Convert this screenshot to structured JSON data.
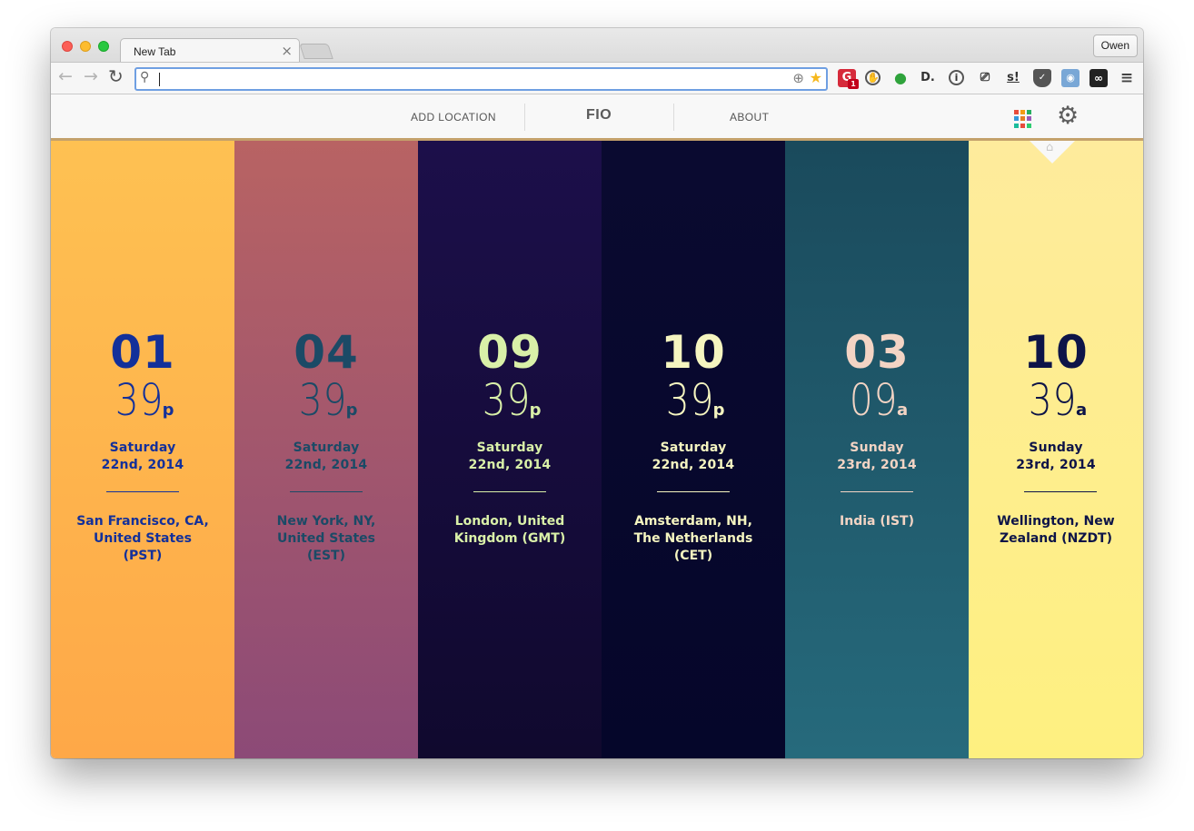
{
  "browser": {
    "tab_title": "New Tab",
    "tab_close": "×",
    "profile_name": "Owen",
    "address_value": "",
    "icons": {
      "back": "back-arrow-icon",
      "forward": "forward-arrow-icon",
      "reload": "reload-icon",
      "search": "search-icon",
      "star": "bookmark-star-icon",
      "menu": "hamburger-menu-icon"
    },
    "extensions": [
      {
        "name": "grammarly-extension-icon",
        "glyph": "G",
        "badge": "1"
      },
      {
        "name": "ghostery-extension-icon",
        "glyph": "◌"
      },
      {
        "name": "evernote-extension-icon",
        "glyph": "●"
      },
      {
        "name": "d-extension-icon",
        "glyph": "D."
      },
      {
        "name": "1password-extension-icon",
        "glyph": "i"
      },
      {
        "name": "cast-extension-icon",
        "glyph": "⌐"
      },
      {
        "name": "s-extension-icon",
        "glyph": "s!"
      },
      {
        "name": "pocket-extension-icon",
        "glyph": "✓"
      },
      {
        "name": "camera-extension-icon",
        "glyph": "◉"
      },
      {
        "name": "loop-extension-icon",
        "glyph": "∞"
      }
    ]
  },
  "app": {
    "nav": {
      "add_location": "ADD LOCATION",
      "brand": "FIO",
      "about": "ABOUT"
    },
    "accent_bar_color": "#c4a16b",
    "grid_colors": [
      "#e74c3c",
      "#f39c12",
      "#27ae60",
      "#3498db",
      "#e67e22",
      "#9b59b6",
      "#1abc9c",
      "#e74c3c",
      "#2ecc71"
    ],
    "home_icon": "home-icon",
    "locations": [
      {
        "hour": "01",
        "minute": "39",
        "ampm": "p",
        "weekday": "Saturday",
        "date": "22nd, 2014",
        "place": "San Francisco, CA, United States (PST)",
        "bg_top": "#fec152",
        "bg_bottom": "#fea848",
        "fg": "#13309a"
      },
      {
        "hour": "04",
        "minute": "39",
        "ampm": "p",
        "weekday": "Saturday",
        "date": "22nd, 2014",
        "place": "New York, NY, United States (EST)",
        "bg_top": "#b86363",
        "bg_bottom": "#8c4a77",
        "fg": "#1b4a66"
      },
      {
        "hour": "09",
        "minute": "39",
        "ampm": "p",
        "weekday": "Saturday",
        "date": "22nd, 2014",
        "place": "London, United Kingdom (GMT)",
        "bg_top": "#1c0f4a",
        "bg_bottom": "#10092e",
        "fg": "#d9f0a8"
      },
      {
        "hour": "10",
        "minute": "39",
        "ampm": "p",
        "weekday": "Saturday",
        "date": "22nd, 2014",
        "place": "Amsterdam, NH, The Netherlands (CET)",
        "bg_top": "#0a0a30",
        "bg_bottom": "#05062a",
        "fg": "#f5f5c0"
      },
      {
        "hour": "03",
        "minute": "09",
        "ampm": "a",
        "weekday": "Sunday",
        "date": "23rd, 2014",
        "place": "India (IST)",
        "bg_top": "#1a4a5c",
        "bg_bottom": "#266a7c",
        "fg": "#f3d4c4"
      },
      {
        "hour": "10",
        "minute": "39",
        "ampm": "a",
        "weekday": "Sunday",
        "date": "23rd, 2014",
        "place": "Wellington, New Zealand (NZDT)",
        "bg_top": "#feeb9c",
        "bg_bottom": "#fef080",
        "fg": "#0d1448"
      }
    ]
  }
}
